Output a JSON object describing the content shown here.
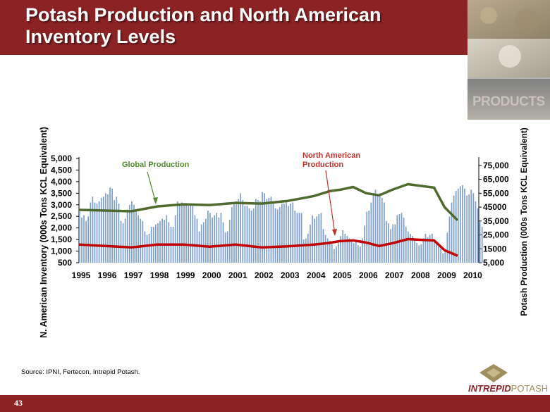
{
  "slide": {
    "title_line1": "Potash Production and North American",
    "title_line2": "Inventory Levels",
    "page_number": "43",
    "source": "Source: IPNI, Fertecon, Intrepid Potash.",
    "photo_label": "PRODUCTS",
    "logo_part1": "INTREPID",
    "logo_part2": "POTASH"
  },
  "colors": {
    "brand_red": "#8b2325",
    "bars": "#7d9fcf",
    "global_line": "#4e6a2c",
    "na_line": "#c00000",
    "annot_global": "#4e8a2c",
    "annot_na": "#c0302a"
  },
  "chart_data": {
    "type": "bar+line",
    "ylabel_left": "N. American Inventory (000s Tons KCL Equivalent)",
    "ylabel_right": "Potash Production (000s Tons KCL Equivalent)",
    "ylim_left": [
      500,
      5000
    ],
    "yticks_left": [
      "500",
      "1,000",
      "1,500",
      "2,000",
      "2,500",
      "3,000",
      "3,500",
      "4,000",
      "4,500",
      "5,000"
    ],
    "ylim_right": [
      5000,
      80000
    ],
    "yticks_right": [
      "5,000",
      "15000",
      "25,000",
      "35,000",
      "45000",
      "55,000",
      "65,000",
      "75,000"
    ],
    "x_ticks": [
      "1995",
      "1996",
      "1997",
      "1998",
      "1999",
      "2000",
      "2001",
      "2002",
      "2003",
      "2004",
      "2005",
      "2006",
      "2007",
      "2008",
      "2009",
      "2010"
    ],
    "annotations": [
      {
        "text": "Global Production",
        "series": "global"
      },
      {
        "text_line1": "North American",
        "text_line2": "Production",
        "series": "na"
      }
    ],
    "series": [
      {
        "name": "N. American Inventory",
        "type": "bar",
        "start": "1995-01",
        "frequency": "monthly",
        "values": [
          2800,
          2450,
          2550,
          2300,
          2500,
          3100,
          3350,
          3100,
          3050,
          3150,
          3300,
          3350,
          3500,
          3450,
          3750,
          3700,
          3200,
          3350,
          3050,
          2300,
          2200,
          2400,
          2800,
          3000,
          3150,
          3000,
          2750,
          2550,
          2400,
          2300,
          1850,
          1700,
          1750,
          2050,
          2050,
          2150,
          2200,
          2300,
          2400,
          2350,
          2550,
          2250,
          2050,
          2050,
          2550,
          3150,
          3050,
          3100,
          3000,
          3000,
          2950,
          2950,
          2950,
          2550,
          2400,
          1850,
          2150,
          2250,
          2400,
          2750,
          2650,
          2450,
          2550,
          2650,
          2450,
          2650,
          2250,
          1800,
          1850,
          2350,
          2900,
          3050,
          3150,
          3250,
          3500,
          3200,
          2950,
          2950,
          2850,
          2750,
          2850,
          3250,
          3200,
          3150,
          3550,
          3500,
          3250,
          3300,
          3350,
          3150,
          2850,
          2800,
          2900,
          3050,
          3050,
          3200,
          2950,
          3050,
          3100,
          2750,
          2650,
          2650,
          2650,
          1500,
          1550,
          1750,
          2150,
          2550,
          2400,
          2500,
          2600,
          2650,
          1950,
          1700,
          1550,
          1450,
          1300,
          1100,
          1200,
          1350,
          1650,
          1900,
          1750,
          1650,
          1550,
          1450,
          1350,
          1450,
          1250,
          1200,
          1550,
          2100,
          2700,
          2750,
          3100,
          3400,
          3650,
          3450,
          3500,
          3300,
          3100,
          2300,
          2200,
          1950,
          2150,
          2150,
          2550,
          2600,
          2650,
          2450,
          2050,
          1850,
          1750,
          1650,
          1550,
          1350,
          1250,
          1300,
          1550,
          1750,
          1600,
          1700,
          1750,
          1500,
          1300,
          1200,
          1100,
          900,
          1000,
          1800,
          2500,
          3100,
          3400,
          3600,
          3700,
          3800,
          3850,
          3700,
          3400,
          3450,
          3650,
          3500,
          3150,
          2850,
          2250,
          2050
        ]
      },
      {
        "name": "Global Production",
        "type": "line",
        "x": [
          "1995",
          "1996",
          "1997",
          "1998",
          "1999",
          "2000",
          "2001",
          "2002",
          "2003",
          "2003.6",
          "2004",
          "2004.6",
          "2005",
          "2005.5",
          "2006",
          "2006.5",
          "2007",
          "2007.6",
          "2008",
          "2008.6",
          "2009",
          "2009.5"
        ],
        "values": [
          43000,
          42500,
          42000,
          45500,
          47000,
          46500,
          48000,
          47500,
          49500,
          51500,
          53000,
          56500,
          57500,
          59500,
          55000,
          53500,
          57500,
          61500,
          60500,
          59000,
          45000,
          35500
        ]
      },
      {
        "name": "North American Production",
        "type": "line",
        "x": [
          "1995",
          "1996",
          "1997",
          "1998",
          "1999",
          "2000",
          "2001",
          "2002",
          "2003",
          "2004",
          "2004.5",
          "2005",
          "2005.5",
          "2006",
          "2006.5",
          "2007",
          "2007.6",
          "2008",
          "2008.6",
          "2009",
          "2009.5"
        ],
        "values": [
          18000,
          17000,
          16000,
          18000,
          18000,
          16500,
          18000,
          16000,
          16800,
          18000,
          19000,
          20500,
          21000,
          19500,
          17000,
          19000,
          22000,
          21500,
          21000,
          14000,
          10000
        ]
      }
    ]
  }
}
